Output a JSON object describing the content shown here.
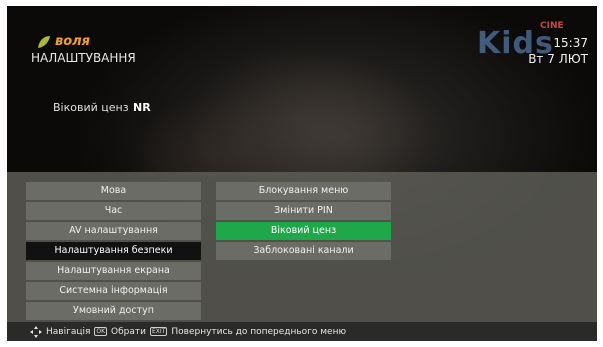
{
  "header": {
    "logo_text": "воля",
    "title": "НАЛАШТУВАННЯ",
    "channel_logo": {
      "main": "Kids",
      "sub": "CINE"
    },
    "time": "15:37",
    "date": "Вт 7 ЛЮТ"
  },
  "age_rating": {
    "label": "Віковий ценз",
    "value": "NR"
  },
  "menu_left": [
    {
      "label": "Мова"
    },
    {
      "label": "Час"
    },
    {
      "label": "AV налаштування"
    },
    {
      "label": "Налаштування безпеки"
    },
    {
      "label": "Налаштування екрана"
    },
    {
      "label": "Системна інформація"
    },
    {
      "label": "Умовний доступ"
    }
  ],
  "menu_right": [
    {
      "label": "Блокування меню"
    },
    {
      "label": "Змінити PIN"
    },
    {
      "label": "Віковий ценз"
    },
    {
      "label": "Заблоковані канали"
    }
  ],
  "footer": {
    "nav_label": "Навігація",
    "ok_key": "OK",
    "select_label": "Обрати",
    "back_key": "EXIT",
    "back_label": "Повернутись до попереднього меню"
  },
  "colors": {
    "accent": "#1ea84a",
    "logo": "#f0a020"
  },
  "icons": [
    "leaf-logo-icon",
    "navigation-arrows-icon"
  ]
}
